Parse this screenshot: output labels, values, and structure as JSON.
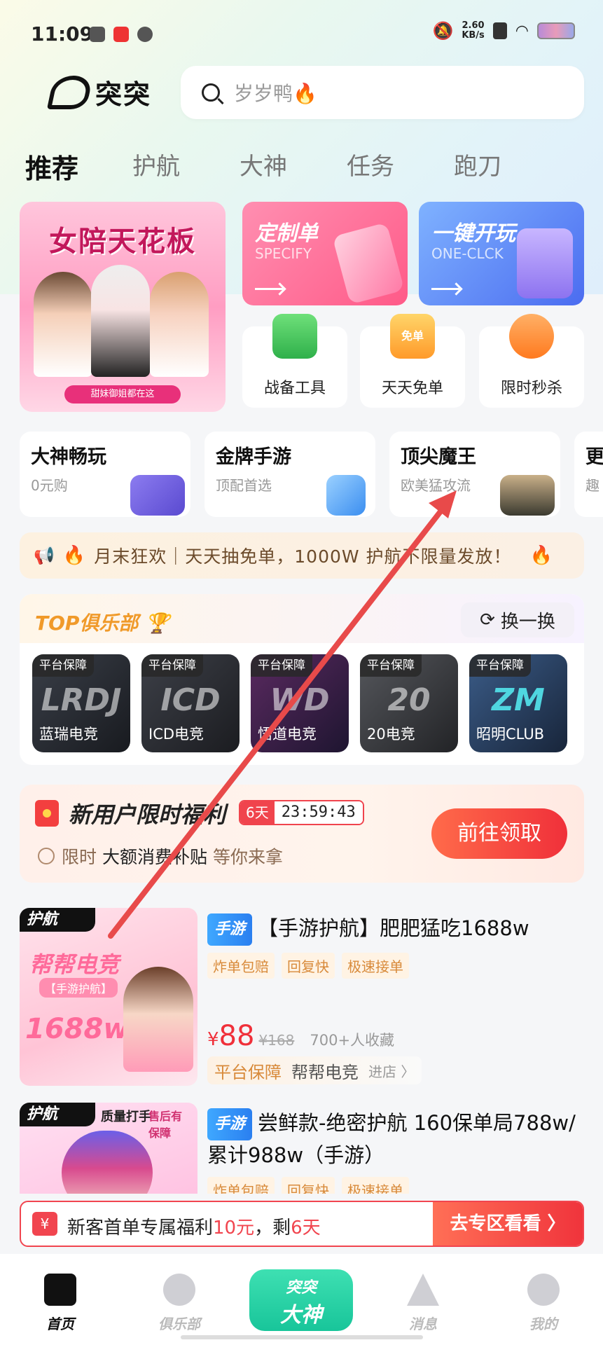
{
  "status_bar": {
    "time": "11:09",
    "net_speed_value": "2.60",
    "net_speed_unit": "KB/s"
  },
  "header": {
    "logo_text": "突突",
    "search_placeholder": "岁岁鸭🔥"
  },
  "tabs": [
    {
      "label": "推荐",
      "active": true
    },
    {
      "label": "护航"
    },
    {
      "label": "大神"
    },
    {
      "label": "任务"
    },
    {
      "label": "跑刀"
    }
  ],
  "promo": {
    "big_banner_title": "女陪天花板",
    "big_banner_sub": "甜妹御姐都在这",
    "specify_title": "定制单",
    "specify_sub": "SPECIFY",
    "oneclick_title": "一键开玩",
    "oneclick_sub": "ONE-CLCK",
    "mini": [
      {
        "label": "战备工具"
      },
      {
        "label": "天天免单",
        "badge": "免单"
      },
      {
        "label": "限时秒杀"
      }
    ]
  },
  "categories": [
    {
      "title": "大神畅玩",
      "sub": "0元购"
    },
    {
      "title": "金牌手游",
      "sub": "顶配首选"
    },
    {
      "title": "顶尖魔王",
      "sub": "欧美猛攻流"
    },
    {
      "title": "更",
      "sub": "趣"
    }
  ],
  "notice": {
    "text": "月末狂欢｜天天抽免单，1000W 护航不限量发放！"
  },
  "clubs": {
    "title": "TOP俱乐部",
    "refresh_label": "换一换",
    "badge": "平台保障",
    "items": [
      {
        "name": "蓝瑞电竞",
        "logo": "LRDJ",
        "color": "#2b2f38"
      },
      {
        "name": "ICD电竞",
        "logo": "ICD",
        "color": "#2a2c33"
      },
      {
        "name": "悟道电竞",
        "logo": "WD",
        "color": "#3a2450"
      },
      {
        "name": "20电竞",
        "logo": "20",
        "color": "#3a3a3c"
      },
      {
        "name": "昭明CLUB",
        "logo": "ZM",
        "color": "#2a3a52"
      }
    ]
  },
  "new_user": {
    "title": "新用户限时福利",
    "days": "6天",
    "time": "23:59:43",
    "desc_prefix": "限时",
    "desc_highlight": "大额消费补贴",
    "desc_suffix": "等你来拿",
    "button": "前往领取"
  },
  "products": [
    {
      "img_tag": "护航",
      "img_title": "帮帮电竞",
      "img_sub": "【手游护航】",
      "img_price": "1688w",
      "platform": "手游",
      "title": "【手游护航】肥肥猛吃1688w",
      "features": [
        "炸单包赔",
        "回复快",
        "极速接单"
      ],
      "currency": "¥",
      "price": "88",
      "old_price": "¥168",
      "favs": "700+人收藏",
      "guard": "平台保障",
      "shop": "帮帮电竞",
      "shop_link": "进店"
    },
    {
      "img_tag": "护航",
      "img_title": "质量打手",
      "img_sub": "售后有保障",
      "platform": "手游",
      "title": "尝鲜款-绝密护航 160保单局788w/累计988w（手游）",
      "features": [
        "炸单包赔",
        "回复快",
        "极速接单"
      ]
    }
  ],
  "coupon_bar": {
    "icon": "¥",
    "text_a": "新客首单专属福利",
    "amount": "10元",
    "text_b": "，剩",
    "days": "6天",
    "go": "去专区看看 〉"
  },
  "bottom_nav": [
    {
      "label": "首页",
      "active": true
    },
    {
      "label": "俱乐部"
    },
    {
      "label": "突突",
      "label2": "大神"
    },
    {
      "label": "消息"
    },
    {
      "label": "我的"
    }
  ],
  "colors": {
    "accent_red": "#f0303a",
    "accent_green": "#18c59a",
    "annotation_arrow": "#e84a4a"
  }
}
